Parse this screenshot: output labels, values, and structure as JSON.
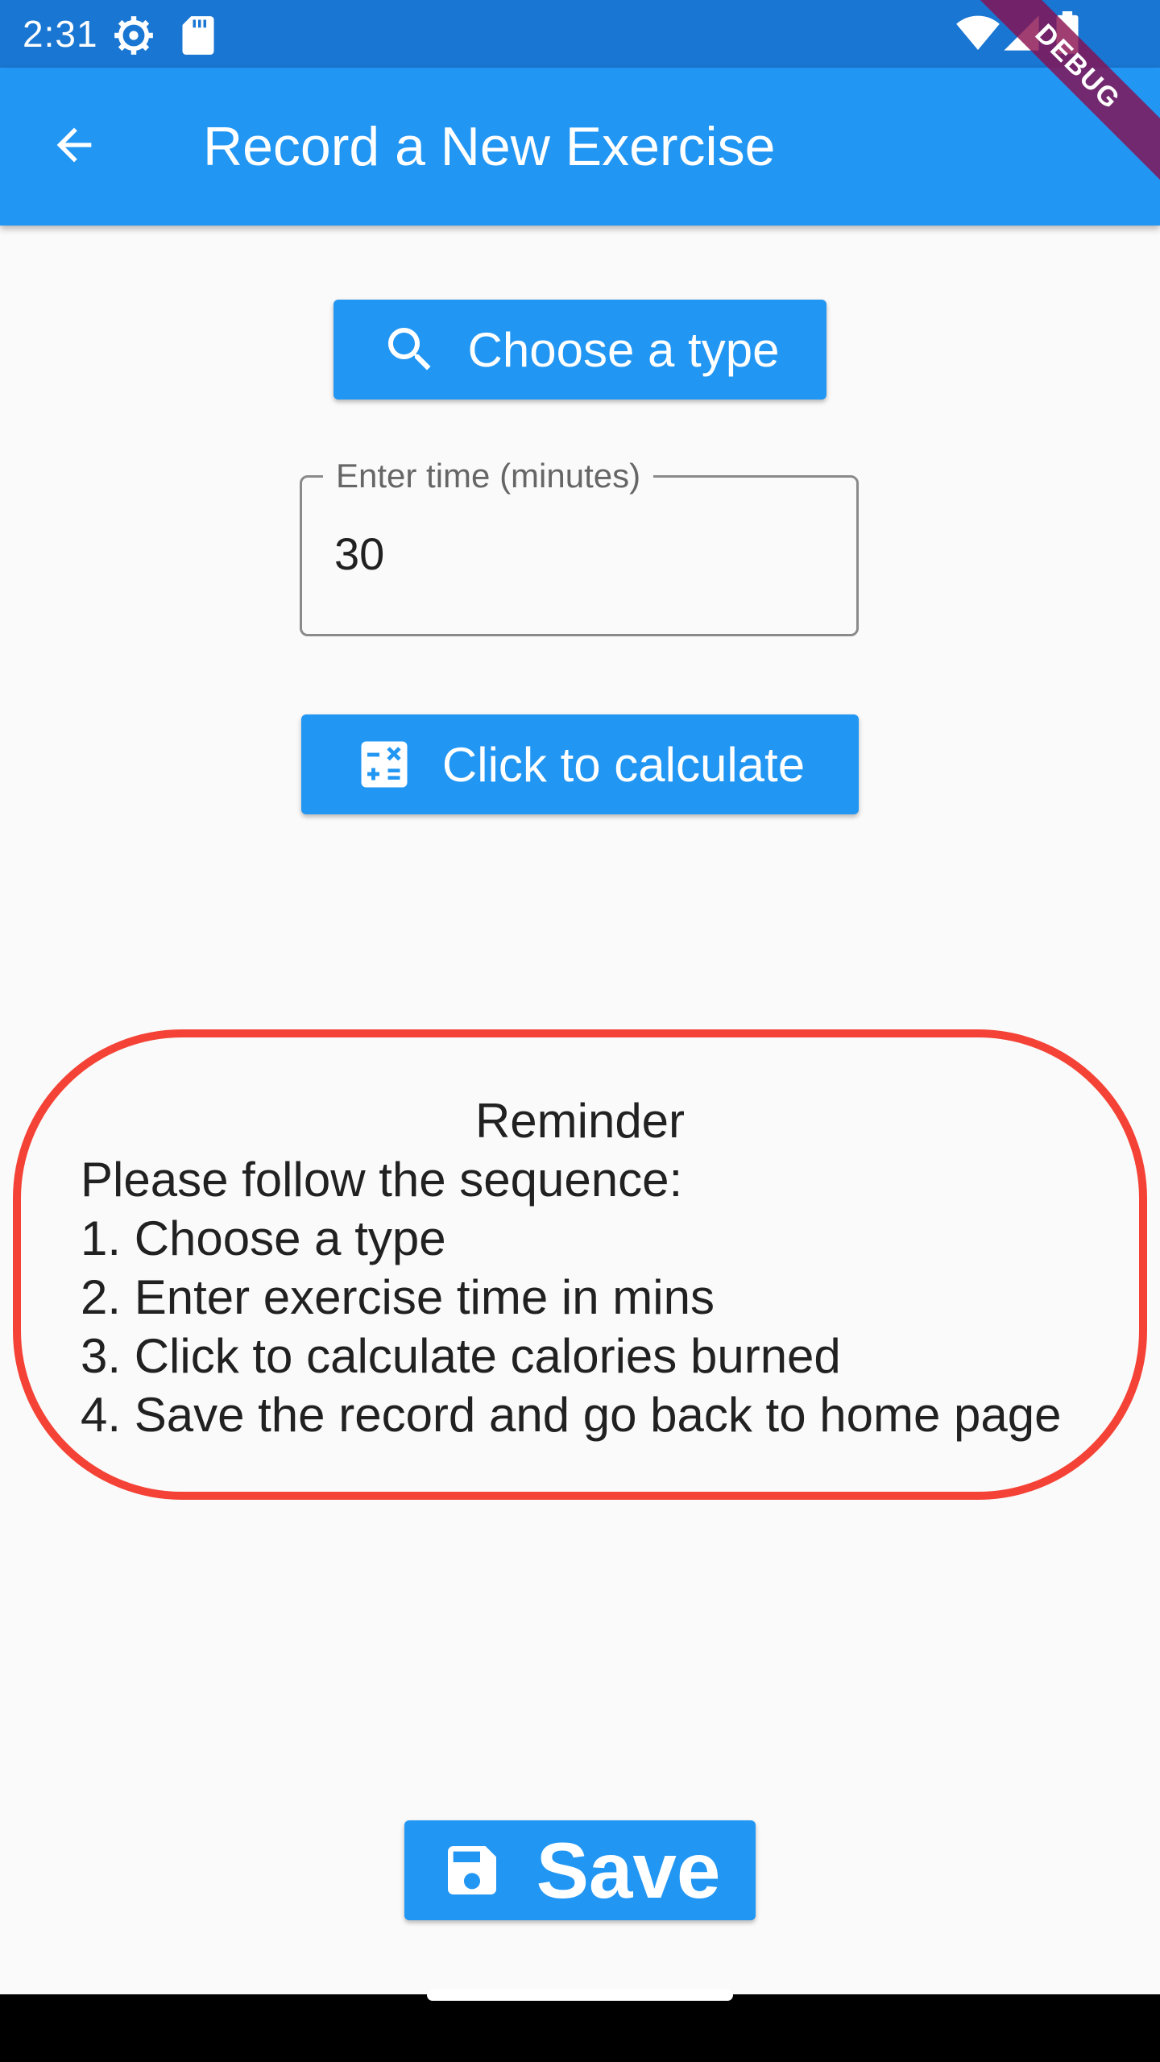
{
  "status_bar": {
    "time": "2:31",
    "icons": [
      "settings-gear-icon",
      "sd-card-icon",
      "wifi-icon",
      "cellular-signal-icon",
      "battery-icon"
    ]
  },
  "app_bar": {
    "title": "Record a New Exercise",
    "back_icon": "arrow-back-icon",
    "color": "#2196f3"
  },
  "debug_banner": "DEBUG",
  "choose_button": {
    "label": "Choose a type",
    "icon": "search-icon"
  },
  "time_input": {
    "label": "Enter time (minutes)",
    "value": "30"
  },
  "calculate_button": {
    "label": "Click to calculate",
    "icon": "calculator-icon"
  },
  "reminder": {
    "title": "Reminder",
    "lines": [
      "Please follow the sequence:",
      "1. Choose a type",
      "2. Enter exercise time in mins",
      "3. Click to calculate calories burned",
      "4. Save the record and go back to home page"
    ],
    "border_color": "#f44336"
  },
  "save_button": {
    "label": "Save",
    "icon": "save-floppy-icon"
  },
  "colors": {
    "primary": "#2196f3",
    "status_bar": "#1976d2",
    "background": "#fafafa"
  }
}
